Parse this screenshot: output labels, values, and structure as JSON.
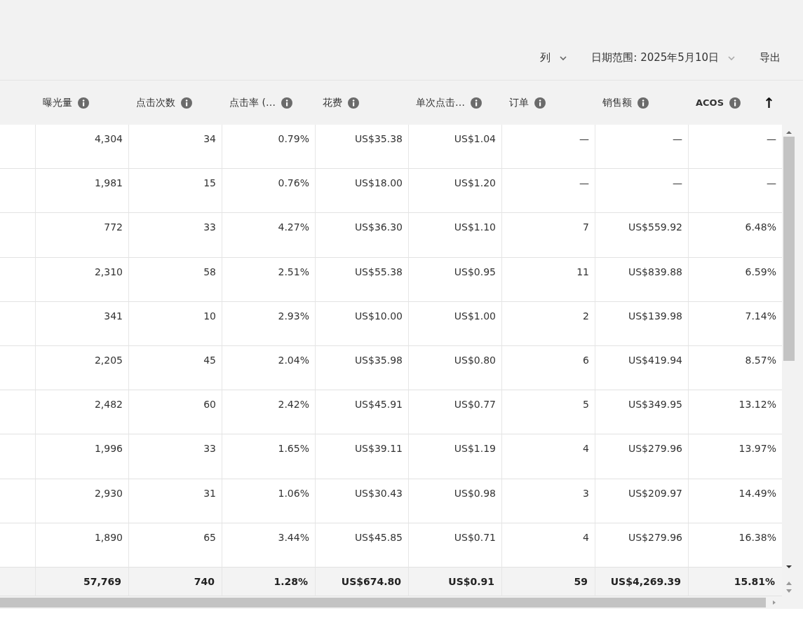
{
  "toolbar": {
    "columns_button": "列",
    "date_range": "日期范围: 2025年5月10日",
    "export": "导出"
  },
  "table": {
    "columns": [
      {
        "label": "曝光量",
        "sorted": false
      },
      {
        "label": "点击次数",
        "sorted": false
      },
      {
        "label": "点击率 (…",
        "sorted": false
      },
      {
        "label": "花费",
        "sorted": false
      },
      {
        "label": "单次点击…",
        "sorted": false
      },
      {
        "label": "订单",
        "sorted": false
      },
      {
        "label": "销售额",
        "sorted": false
      },
      {
        "label": "ACOS",
        "sorted": true
      }
    ],
    "sort_arrow": "↑",
    "rows": [
      [
        "4,304",
        "34",
        "0.79%",
        "US$35.38",
        "US$1.04",
        "—",
        "—",
        "—"
      ],
      [
        "1,981",
        "15",
        "0.76%",
        "US$18.00",
        "US$1.20",
        "—",
        "—",
        "—"
      ],
      [
        "772",
        "33",
        "4.27%",
        "US$36.30",
        "US$1.10",
        "7",
        "US$559.92",
        "6.48%"
      ],
      [
        "2,310",
        "58",
        "2.51%",
        "US$55.38",
        "US$0.95",
        "11",
        "US$839.88",
        "6.59%"
      ],
      [
        "341",
        "10",
        "2.93%",
        "US$10.00",
        "US$1.00",
        "2",
        "US$139.98",
        "7.14%"
      ],
      [
        "2,205",
        "45",
        "2.04%",
        "US$35.98",
        "US$0.80",
        "6",
        "US$419.94",
        "8.57%"
      ],
      [
        "2,482",
        "60",
        "2.42%",
        "US$45.91",
        "US$0.77",
        "5",
        "US$349.95",
        "13.12%"
      ],
      [
        "1,996",
        "33",
        "1.65%",
        "US$39.11",
        "US$1.19",
        "4",
        "US$279.96",
        "13.97%"
      ],
      [
        "2,930",
        "31",
        "1.06%",
        "US$30.43",
        "US$0.98",
        "3",
        "US$209.97",
        "14.49%"
      ],
      [
        "1,890",
        "65",
        "3.44%",
        "US$45.85",
        "US$0.71",
        "4",
        "US$279.96",
        "16.38%"
      ]
    ],
    "totals": [
      "57,769",
      "740",
      "1.28%",
      "US$674.80",
      "US$0.91",
      "59",
      "US$4,269.39",
      "15.81%"
    ]
  }
}
